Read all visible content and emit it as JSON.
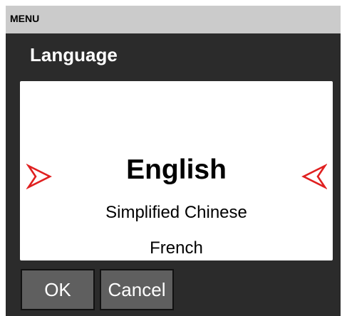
{
  "menu_bar": {
    "label": "MENU"
  },
  "screen": {
    "title": "Language"
  },
  "picker": {
    "selected": "English",
    "following": [
      "Simplified Chinese",
      "French"
    ],
    "arrow_left_icon": "arrow-right-pointer-icon",
    "arrow_right_icon": "arrow-left-pointer-icon",
    "arrow_color": "#e02020"
  },
  "buttons": {
    "ok_label": "OK",
    "cancel_label": "Cancel"
  }
}
